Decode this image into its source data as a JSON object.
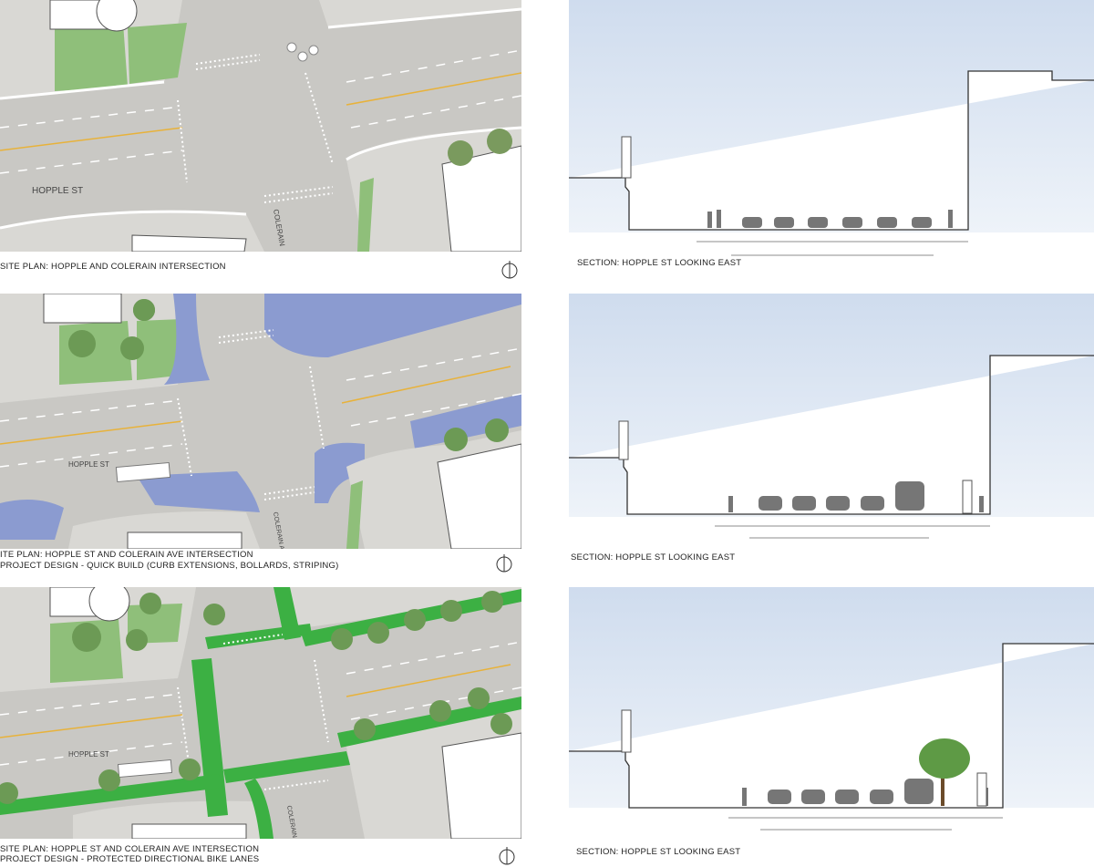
{
  "plans": [
    {
      "street_label": "HOPPLE ST",
      "cross_label": "COLERAIN",
      "caption_lines": [
        "SITE PLAN: HOPPLE AND COLERAIN INTERSECTION"
      ]
    },
    {
      "street_label": "HOPPLE ST",
      "cross_label": "COLERAIN AVE",
      "caption_lines": [
        "ITE PLAN: HOPPLE ST AND COLERAIN AVE INTERSECTION",
        "PROJECT DESIGN - QUICK BUILD (CURB EXTENSIONS, BOLLARDS, STRIPING)"
      ]
    },
    {
      "street_label": "HOPPLE ST",
      "cross_label": "COLERAIN AVE",
      "caption_lines": [
        "SITE PLAN: HOPPLE ST AND COLERAIN AVE INTERSECTION",
        "PROJECT DESIGN - PROTECTED DIRECTIONAL BIKE LANES"
      ]
    }
  ],
  "sections": [
    {
      "caption": "SECTION: HOPPLE ST LOOKING EAST"
    },
    {
      "caption": "SECTION: HOPPLE ST LOOKING EAST"
    },
    {
      "caption": "SECTION: HOPPLE ST LOOKING EAST"
    }
  ],
  "colors": {
    "sky": "#dbe6f3",
    "road": "#c9c9c7",
    "grass": "#8fbf7a",
    "bike_lane": "#3cb043",
    "curb_ext": "#8b9bd0",
    "marking_yellow": "#e8b23a"
  }
}
